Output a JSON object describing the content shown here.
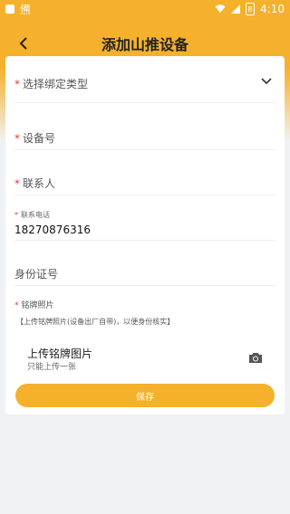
{
  "status_bar": {
    "left_glyph": "㷶",
    "time": "4:10",
    "battery_text": "8"
  },
  "header": {
    "title": "添加山推设备",
    "back_icon": "chevron-left-icon",
    "color": "#f5b12c"
  },
  "form": {
    "binding_type": {
      "label": "选择绑定类型",
      "required_mark": "*"
    },
    "device_no": {
      "label": "设备号",
      "required_mark": "*"
    },
    "contact": {
      "label": "联系人",
      "required_mark": "*"
    },
    "phone": {
      "label": "联系电话",
      "required_mark": "*",
      "value": "18270876316"
    },
    "id_number": {
      "label": "身份证号"
    },
    "nameplate": {
      "label": "铭牌照片",
      "required_mark": "*",
      "note": "【上传铭牌照片(设备出厂自带)，以便身份核实】",
      "upload_title": "上传铭牌图片",
      "upload_subtitle": "只能上传一张"
    }
  },
  "actions": {
    "save_label": "保存"
  }
}
